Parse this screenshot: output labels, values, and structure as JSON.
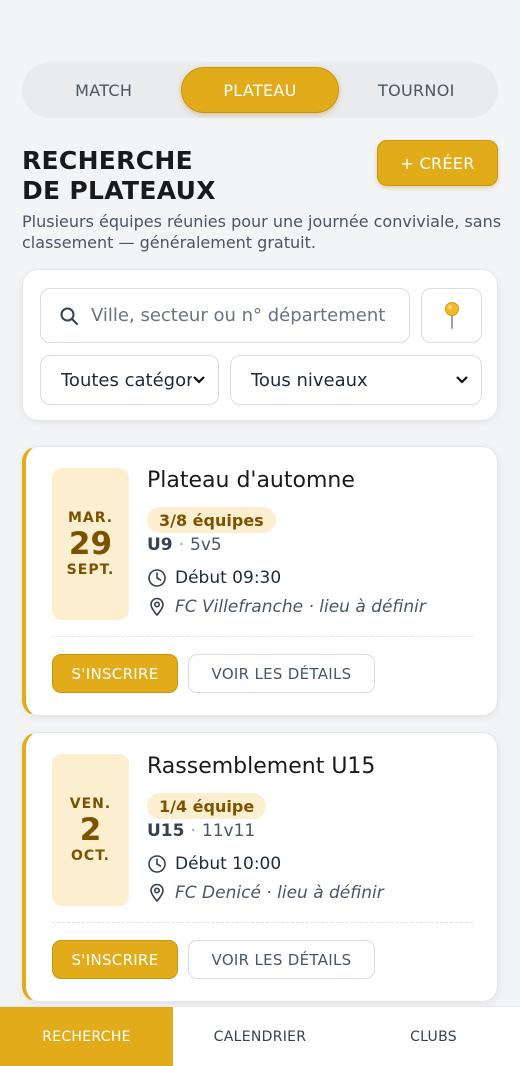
{
  "tabs": [
    {
      "label": "MATCH",
      "active": false
    },
    {
      "label": "PLATEAU",
      "active": true
    },
    {
      "label": "TOURNOI",
      "active": false
    }
  ],
  "header": {
    "title_line1": "RECHERCHE",
    "title_line2": "DE PLATEAUX",
    "create_label": "+ CRÉER",
    "subtitle": "Plusieurs équipes réunies pour une journée conviviale, sans classement — généralement gratuit."
  },
  "filters": {
    "search_placeholder": "Ville, secteur ou n° département",
    "search_icon": "search-icon",
    "location_icon": "pin-icon",
    "category_selected": "Toutes catégories",
    "level_selected": "Tous niveaux"
  },
  "events": [
    {
      "dow": "MAR.",
      "day": "29",
      "month": "SEPT.",
      "title": "Plateau d'automne",
      "teams_badge": "3/8 équipes",
      "category": "U9",
      "format": "5v5",
      "start": "Début 09:30",
      "place": "FC Villefranche · lieu à définir",
      "register_label": "S'INSCRIRE",
      "details_label": "VOIR LES DÉTAILS"
    },
    {
      "dow": "VEN.",
      "day": "2",
      "month": "OCT.",
      "title": "Rassemblement U15",
      "teams_badge": "1/4 équipe",
      "category": "U15",
      "format": "11v11",
      "start": "Début 10:00",
      "place": "FC Denicé · lieu à définir",
      "register_label": "S'INSCRIRE",
      "details_label": "VOIR LES DÉTAILS"
    }
  ],
  "nav": [
    {
      "label": "RECHERCHE",
      "active": true
    },
    {
      "label": "CALENDRIER",
      "active": false
    },
    {
      "label": "CLUBS",
      "active": false
    }
  ],
  "colors": {
    "accent": "#e2ab1a",
    "date_bg": "#fcefcf",
    "date_text": "#7a5200"
  }
}
